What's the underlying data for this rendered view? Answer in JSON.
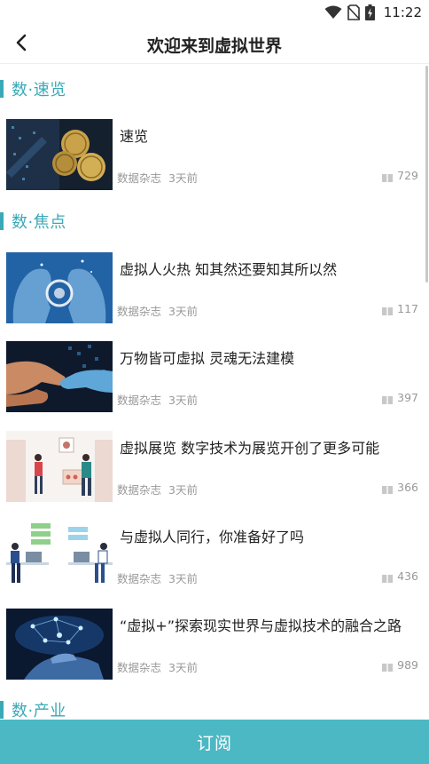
{
  "status_bar": {
    "time": "11:22",
    "icons": [
      "wifi-icon",
      "no-sim-icon",
      "battery-charging-icon"
    ]
  },
  "header": {
    "title": "欢迎来到虚拟世界",
    "back_icon": "chevron-left-icon"
  },
  "sections": [
    {
      "title": "数·速览",
      "articles": [
        {
          "title": "速览",
          "source": "数据杂志",
          "time": "3天前",
          "views": "729",
          "thumb": "coins-thumb"
        }
      ]
    },
    {
      "title": "数·焦点",
      "articles": [
        {
          "title": "虚拟人火热 知其然还要知其所以然",
          "source": "数据杂志",
          "time": "3天前",
          "views": "117",
          "thumb": "ai-heads-thumb"
        },
        {
          "title": "万物皆可虚拟 灵魂无法建模",
          "source": "数据杂志",
          "time": "3天前",
          "views": "397",
          "thumb": "handshake-thumb"
        },
        {
          "title": "虚拟展览 数字技术为展览开创了更多可能",
          "source": "数据杂志",
          "time": "3天前",
          "views": "366",
          "thumb": "exhibition-thumb"
        },
        {
          "title": "与虚拟人同行，你准备好了吗",
          "source": "数据杂志",
          "time": "3天前",
          "views": "436",
          "thumb": "laptop-people-thumb"
        },
        {
          "title": "“虚拟+”探索现实世界与虚拟技术的融合之路",
          "source": "数据杂志",
          "time": "3天前",
          "views": "989",
          "thumb": "hand-network-thumb"
        }
      ]
    },
    {
      "title": "数·产业",
      "articles": []
    }
  ],
  "footer": {
    "subscribe_label": "订阅"
  },
  "colors": {
    "accent": "#3aa9b7",
    "subscribe_bg": "#4cb8c4",
    "meta_text": "#999999"
  }
}
